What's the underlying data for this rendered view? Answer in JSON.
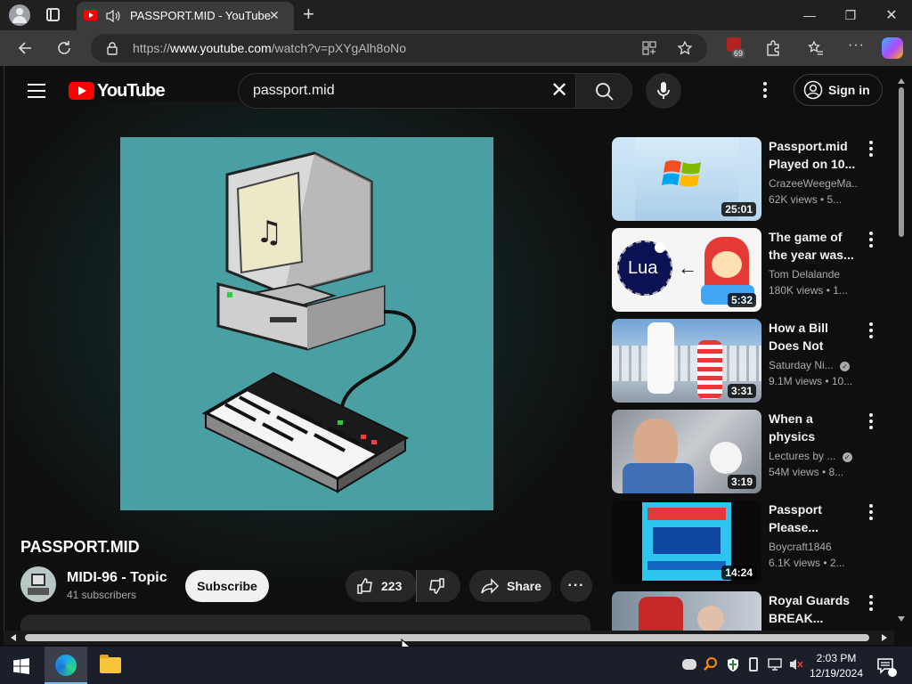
{
  "browser": {
    "tab_title": "PASSPORT.MID - YouTube",
    "new_tab": "+",
    "url_prefix": "https://",
    "url_domain": "www.youtube.com",
    "url_path": "/watch?v=pXYgAlh8oNo",
    "extension_badge": "69",
    "minimize": "—",
    "restore": "❐",
    "close": "✕"
  },
  "youtube": {
    "logo_text": "YouTube",
    "search_value": "passport.mid",
    "signin_label": "Sign in"
  },
  "video": {
    "title": "PASSPORT.MID",
    "channel": "MIDI-96 - Topic",
    "subscribers": "41 subscribers",
    "subscribe_label": "Subscribe",
    "likes": "223",
    "share_label": "Share"
  },
  "recommendations": [
    {
      "title": "Passport.mid Played on 10...",
      "channel": "CrazeeWeegeMa...",
      "meta": "62K views • 5...",
      "duration": "25:01",
      "verified": false
    },
    {
      "title": "The game of the year was...",
      "channel": "Tom Delalande",
      "meta": "180K views • 1...",
      "duration": "5:32",
      "verified": false,
      "thumb_text": "Lua"
    },
    {
      "title": "How a Bill Does Not Become a...",
      "channel": "Saturday Ni...",
      "meta": "9.1M views • 10...",
      "duration": "3:31",
      "verified": true
    },
    {
      "title": "When a physics teacher know...",
      "channel": "Lectures by ...",
      "meta": "54M views • 8...",
      "duration": "3:19",
      "verified": true
    },
    {
      "title": "Passport Please...",
      "channel": "Boycraft1846",
      "meta": "6.1K views • 2...",
      "duration": "14:24",
      "verified": false
    },
    {
      "title": "Royal Guards BREAK...",
      "channel": "",
      "meta": "",
      "duration": "",
      "verified": false
    }
  ],
  "taskbar": {
    "time": "2:03 PM",
    "date": "12/19/2024"
  },
  "colors": {
    "youtube_red": "#ff0000",
    "video_bg": "#4a9fa2",
    "page_bg": "#0f0f0f"
  }
}
